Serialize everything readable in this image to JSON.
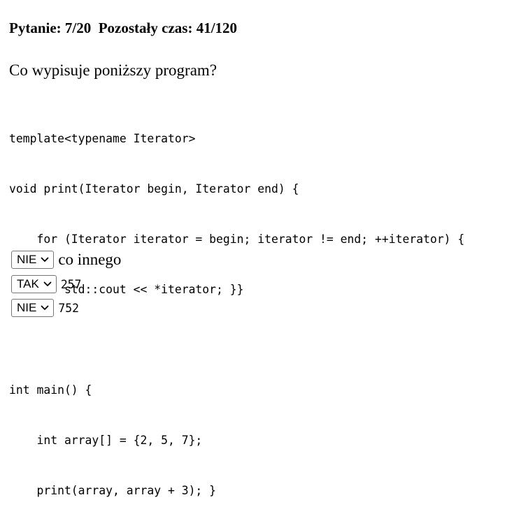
{
  "header": {
    "text": "Pytanie: 7/20  Pozostały czas: 41/120"
  },
  "question": {
    "text": "Co wypisuje poniższy program?"
  },
  "code": {
    "lines": [
      "template<typename Iterator>",
      "void print(Iterator begin, Iterator end) {",
      "    for (Iterator iterator = begin; iterator != end; ++iterator) {",
      "        std::cout << *iterator; }}",
      "",
      "int main() {",
      "    int array[] = {2, 5, 7};",
      "    print(array, array + 3); }"
    ]
  },
  "answers": [
    {
      "selected": "NIE",
      "text": "co innego"
    },
    {
      "selected": "TAK",
      "text": "257"
    },
    {
      "selected": "NIE",
      "text": "752"
    }
  ]
}
